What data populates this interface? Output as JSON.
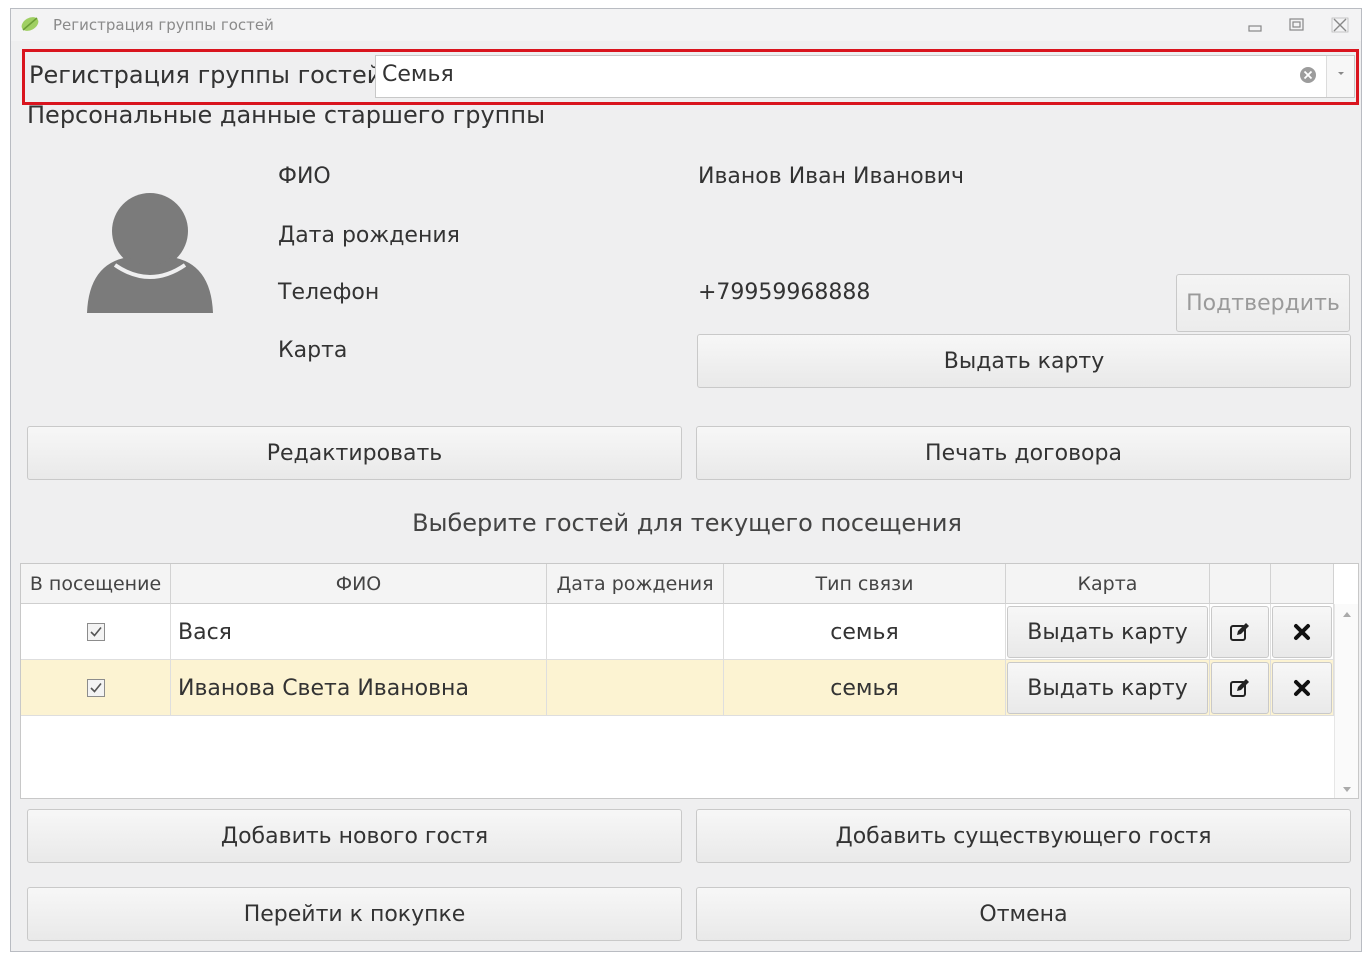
{
  "window": {
    "title": "Регистрация группы гостей"
  },
  "group": {
    "label": "Регистрация группы гостей",
    "selected_value": "Семья"
  },
  "leader": {
    "section_title": "Персональные данные старшего группы",
    "fields": {
      "fio_label": "ФИО",
      "fio_value": "Иванов Иван Иванович",
      "birth_label": "Дата рождения",
      "birth_value": "",
      "phone_label": "Телефон",
      "phone_value": "+79959968888",
      "card_label": "Карта"
    },
    "confirm_button": "Подтвердить",
    "issue_card_button": "Выдать карту",
    "edit_button": "Редактировать",
    "print_button": "Печать договора"
  },
  "guests": {
    "title": "Выберите гостей для текущего посещения",
    "columns": [
      "В посещение",
      "ФИО",
      "Дата рождения",
      "Тип связи",
      "Карта"
    ],
    "rows": [
      {
        "checked": true,
        "fio": "Вася",
        "birth": "",
        "relation": "семья",
        "card_button": "Выдать карту"
      },
      {
        "checked": true,
        "fio": "Иванова Света Ивановна",
        "birth": "",
        "relation": "семья",
        "card_button": "Выдать карту",
        "selected": true
      }
    ]
  },
  "actions": {
    "add_new": "Добавить нового гостя",
    "add_existing": "Добавить существующего гостя",
    "go_to_purchase": "Перейти к покупке",
    "cancel": "Отмена"
  },
  "colors": {
    "highlight_border": "#d9141e",
    "selected_row": "#fcf3d2",
    "avatar": "#7b7b7b"
  },
  "icons": [
    "app-leaf-icon",
    "minimize-icon",
    "maximize-icon",
    "close-icon",
    "clear-icon",
    "dropdown-arrow-icon",
    "user-avatar-icon",
    "edit-icon",
    "delete-icon",
    "scroll-up-icon",
    "scroll-down-icon"
  ]
}
